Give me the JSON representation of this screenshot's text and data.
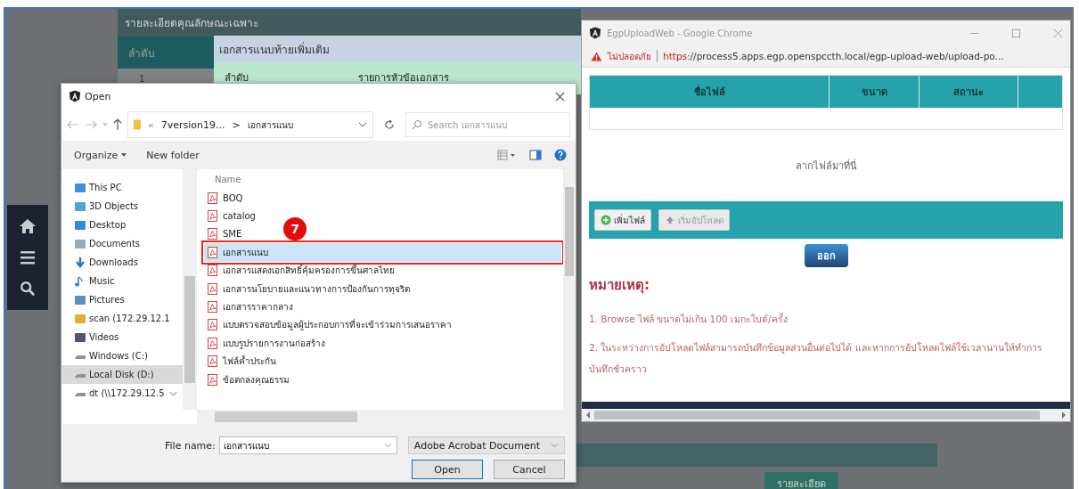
{
  "background_page": {
    "section_title": "รายละเอียดคุณลักษณะเฉพาะ",
    "table_header": [
      "ลำดับ"
    ],
    "row": [
      "1"
    ],
    "attachment_panel": {
      "title": "เอกสารแนบท้ายเพิ่มเติม",
      "columns": [
        "ลำดับ",
        "รายการหัวข้อเอกสาร"
      ]
    },
    "detail_button": "รายละเอียด"
  },
  "open_dialog": {
    "title": "Open",
    "address": {
      "overflow": "«",
      "folder": "7version19...",
      "separator": ">",
      "current": "เอกสารแนบ"
    },
    "search": {
      "placeholder": "Search เอกสารแนบ"
    },
    "toolbar": {
      "organize": "Organize",
      "new_folder": "New folder"
    },
    "nav_items": [
      {
        "label": "This PC",
        "selected": false
      },
      {
        "label": "3D Objects",
        "selected": false
      },
      {
        "label": "Desktop",
        "selected": false
      },
      {
        "label": "Documents",
        "selected": false
      },
      {
        "label": "Downloads",
        "selected": false
      },
      {
        "label": "Music",
        "selected": false
      },
      {
        "label": "Pictures",
        "selected": false
      },
      {
        "label": "scan (172.29.12.1",
        "selected": false
      },
      {
        "label": "Videos",
        "selected": false
      },
      {
        "label": "Windows (C:)",
        "selected": false
      },
      {
        "label": "Local Disk (D:)",
        "selected": true
      },
      {
        "label": "dt (\\\\172.29.12.5",
        "selected": false
      }
    ],
    "column_header": "Name",
    "files": [
      {
        "name": "BOQ",
        "selected": false
      },
      {
        "name": "catalog",
        "selected": false
      },
      {
        "name": "SME",
        "selected": false
      },
      {
        "name": "เอกสารแนบ",
        "selected": true
      },
      {
        "name": "เอกสารแสดงเอกสิทธิ์คุ้มครองการขึ้นศาลไทย",
        "selected": false
      },
      {
        "name": "เอกสารนโยบายและแนวทางการป้องกันการทุจริต",
        "selected": false
      },
      {
        "name": "เอกสารราคากลาง",
        "selected": false
      },
      {
        "name": "แบบตรวจสอบข้อมูลผู้ประกอบการที่จะเข้าร่วมการเสนอราคา",
        "selected": false
      },
      {
        "name": "แบบรูปรายการงานก่อสร้าง",
        "selected": false
      },
      {
        "name": "ไฟล์ค้ำประกัน",
        "selected": false
      },
      {
        "name": "ข้อตกลงคุณธรรม",
        "selected": false
      }
    ],
    "file_name_label": "File name:",
    "file_name": "เอกสารแนบ",
    "file_type": "Adobe Acrobat Document",
    "buttons": [
      "Open",
      "Cancel"
    ]
  },
  "step_badge": "7",
  "upload_window": {
    "title": "EgpUploadWeb - Google Chrome",
    "security": "ไม่ปลอดภัย",
    "url_scheme": "https",
    "url_rest": "://process5.apps.egp.openspccth.local/egp-upload-web/upload-po...",
    "columns": [
      "ชื่อไฟล์",
      "ขนาด",
      "สถานะ"
    ],
    "drop_hint": "ลากไฟล์มาที่นี่",
    "actions": [
      {
        "label": "เพิ่มไฟล์",
        "kind": "add",
        "disabled": false
      },
      {
        "label": "เริ่มอัปโหลด",
        "kind": "upload",
        "disabled": true
      }
    ],
    "exit_button": "ออก",
    "note_title": "หมายเหตุ:",
    "notes": [
      "1. Browse ไฟล์ ขนาดไม่เกิน 100 เมกะไบต์/ครั้ง",
      "2. ในระหว่างการอัปโหลดไฟล์สามารถบันทึกข้อมูลส่วนอื่นต่อไปได้ และหากการอัปโหลดไฟล์ใช้เวลานานให้ทำการบันทึกชั่วคราว"
    ]
  }
}
